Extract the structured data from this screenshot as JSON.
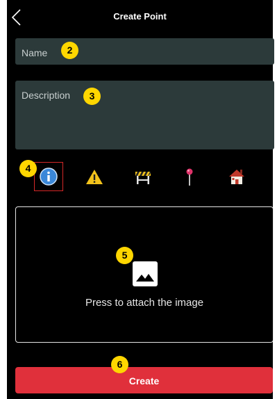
{
  "header": {
    "title": "Create Point",
    "back_icon": "chevron-left-icon"
  },
  "form": {
    "name_placeholder": "Name",
    "description_placeholder": "Description"
  },
  "point_types": [
    {
      "icon": "info-icon",
      "selected": true
    },
    {
      "icon": "warning-icon",
      "selected": false
    },
    {
      "icon": "roadblock-icon",
      "selected": false
    },
    {
      "icon": "map-pin-icon",
      "selected": false
    },
    {
      "icon": "house-icon",
      "selected": false
    }
  ],
  "attachment": {
    "icon": "image-icon",
    "label": "Press to attach the image"
  },
  "actions": {
    "create_label": "Create"
  },
  "callouts": [
    "2",
    "3",
    "4",
    "5",
    "6"
  ],
  "colors": {
    "background": "#000000",
    "field": "#2c3a3a",
    "callout": "#ffd600",
    "primary_button": "#e0303b",
    "selection_outline": "#d62828"
  }
}
